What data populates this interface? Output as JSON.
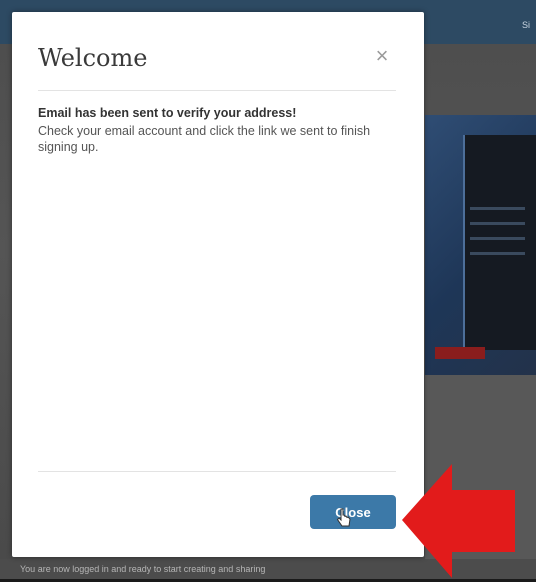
{
  "background": {
    "top_right_text": "Si",
    "footer_text": "You are now logged in and ready to start creating and sharing"
  },
  "modal": {
    "title": "Welcome",
    "close_icon": "close-icon",
    "message_strong": "Email has been sent to verify your address!",
    "message_body": "Check your email account and click the link we sent to finish signing up.",
    "close_button_label": "Close"
  },
  "colors": {
    "primary_button": "#3c79a8",
    "annotation_arrow": "#e21b1b"
  }
}
